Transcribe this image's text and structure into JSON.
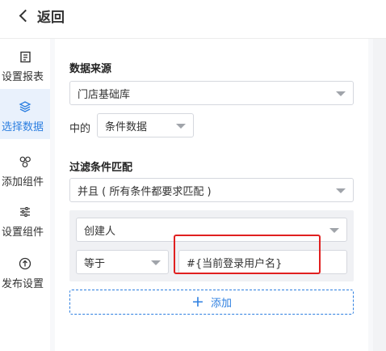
{
  "header": {
    "back_label": "返回"
  },
  "sidebar": {
    "items": [
      {
        "label": "设置报表",
        "icon": "report-icon",
        "active": false
      },
      {
        "label": "选择数据",
        "icon": "layers-icon",
        "active": true
      },
      {
        "label": "添加组件",
        "icon": "components-icon",
        "active": false
      },
      {
        "label": "设置组件",
        "icon": "sliders-icon",
        "active": false
      },
      {
        "label": "发布设置",
        "icon": "publish-icon",
        "active": false
      }
    ]
  },
  "data_source": {
    "title": "数据来源",
    "source_value": "门店基础库",
    "in_label": "中的",
    "data_value": "条件数据"
  },
  "filter": {
    "title": "过滤条件匹配",
    "match_value": "并且 ( 所有条件都要求匹配 )",
    "condition": {
      "field_value": "创建人",
      "operator_value": "等于",
      "value_text": "#{当前登录用户名}"
    },
    "add_label": "添加"
  },
  "colors": {
    "accent": "#2d7fe0",
    "active_bg": "#e9f1fc",
    "highlight_border": "#e02020"
  }
}
